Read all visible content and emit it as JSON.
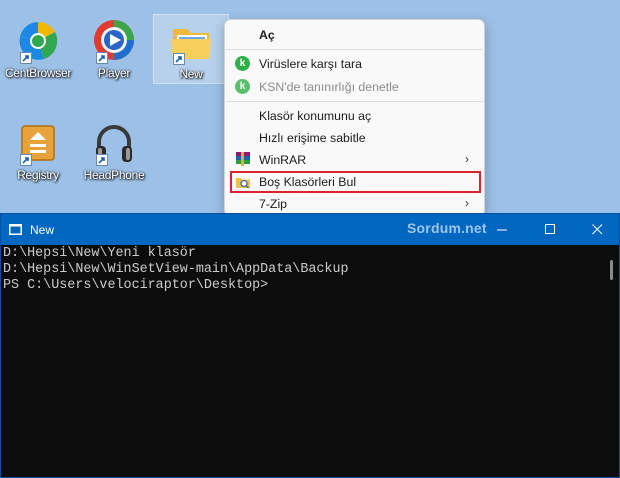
{
  "desktop": {
    "icons": [
      {
        "label": "CentBrowser"
      },
      {
        "label": "Player"
      },
      {
        "label": "New"
      },
      {
        "label": "Registry"
      },
      {
        "label": "HeadPhone"
      }
    ]
  },
  "context_menu": {
    "open": "Aç",
    "scan": "Virüslere karşı tara",
    "ksn": "KSN'de tanınırlığı denetle",
    "open_location": "Klasör konumunu aç",
    "pin_quick": "Hızlı erişime sabitle",
    "winrar": "WinRAR",
    "find_empty": "Boş Klasörleri Bul",
    "sevenzip": "7-Zip"
  },
  "console": {
    "title": "New",
    "watermark": "Sordum.net",
    "lines": [
      "D:\\Hepsi\\New\\Yeni klasör",
      "D:\\Hepsi\\New\\WinSetView-main\\AppData\\Backup",
      "PS C:\\Users\\velociraptor\\Desktop>"
    ]
  },
  "colors": {
    "desktop_bg": "#9cc0e6",
    "titlebar": "#0067c0",
    "console_bg": "#0c0c0c",
    "highlight_border": "#d9232e"
  }
}
